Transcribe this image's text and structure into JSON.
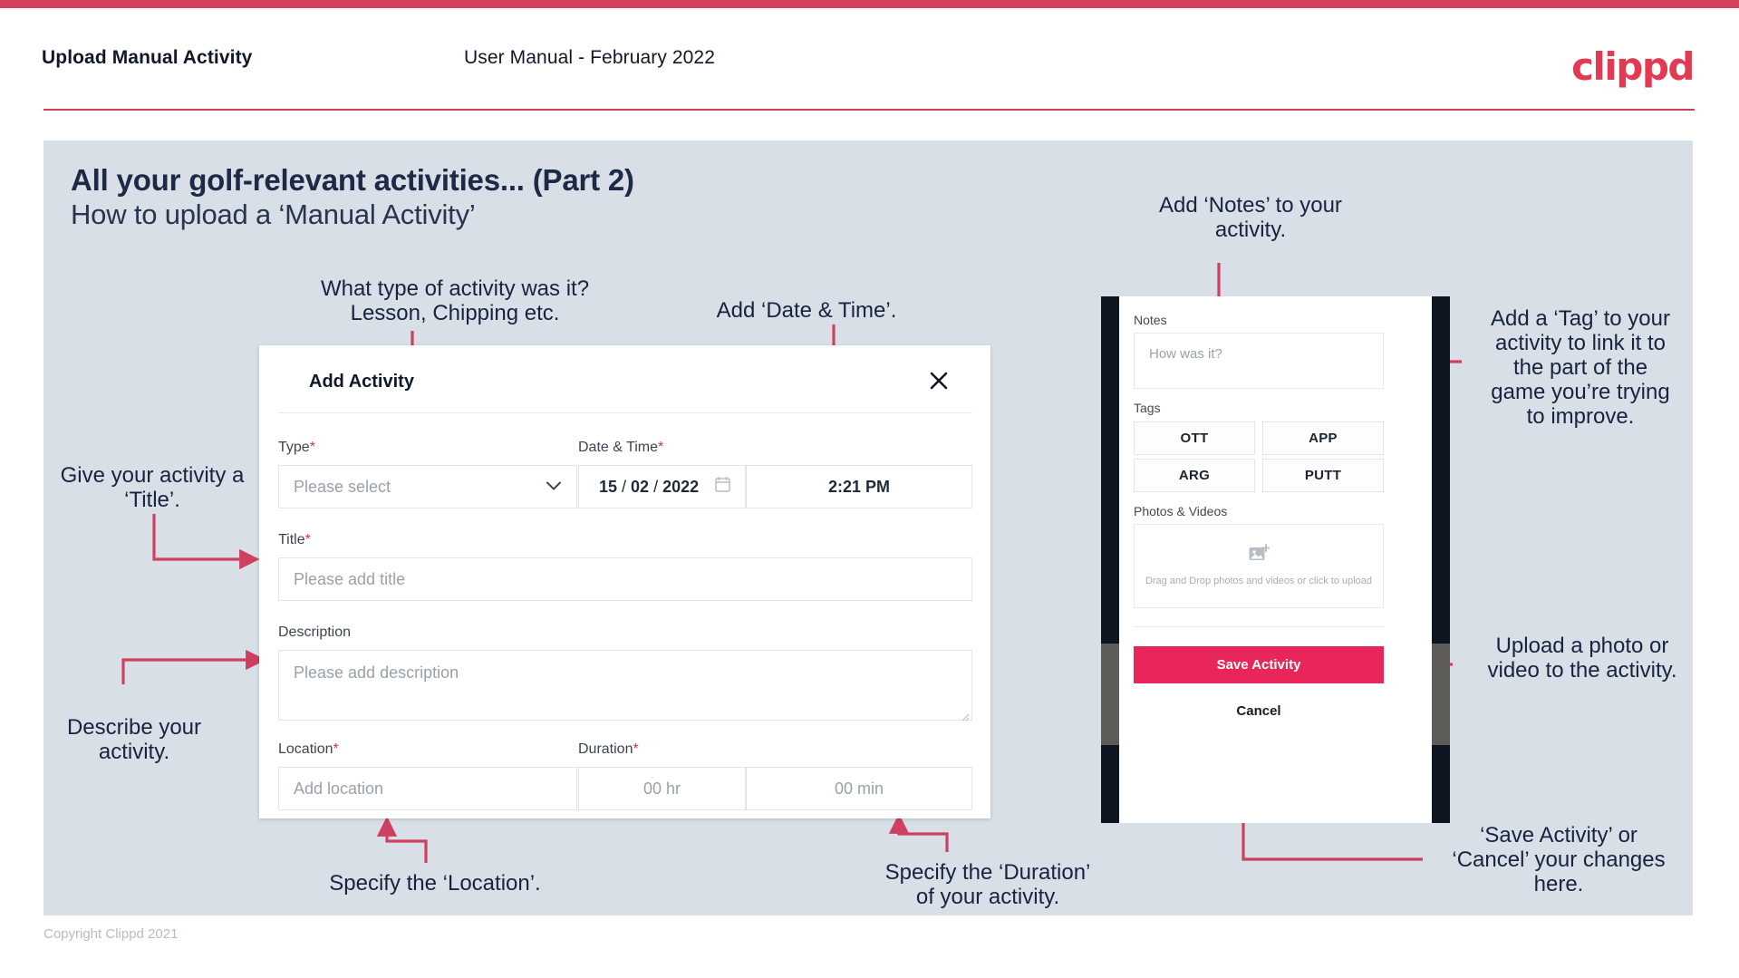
{
  "header": {
    "title": "Upload Manual Activity",
    "subtitle": "User Manual - February 2022",
    "brand": "clippd",
    "accent_color": "#d6425c"
  },
  "slide": {
    "title": "All your golf-relevant activities... (Part 2)",
    "subtitle": "How to upload a ‘Manual Activity’",
    "background_color": "#d8dfe7"
  },
  "annotations": [
    {
      "id": "type-note",
      "text": "What type of activity was it?\nLesson, Chipping etc."
    },
    {
      "id": "datetime-note",
      "text": "Add ‘Date & Time’."
    },
    {
      "id": "title-note",
      "text": "Give your activity a\n‘Title’."
    },
    {
      "id": "desc-note",
      "text": "Describe your\nactivity."
    },
    {
      "id": "location-note",
      "text": "Specify the ‘Location’."
    },
    {
      "id": "duration-note",
      "text": "Specify the ‘Duration’\nof your activity."
    },
    {
      "id": "notes-note",
      "text": "Add ‘Notes’ to your\nactivity."
    },
    {
      "id": "tag-note",
      "text": "Add a ‘Tag’ to your\nactivity to link it to\nthe part of the\ngame you’re trying\nto improve."
    },
    {
      "id": "upload-note",
      "text": "Upload a photo or\nvideo to the activity."
    },
    {
      "id": "save-note",
      "text": "‘Save Activity’ or\n‘Cancel’ your changes\nhere."
    }
  ],
  "dialog": {
    "title": "Add Activity",
    "close_icon": "close-icon",
    "fields": {
      "type": {
        "label": "Type",
        "required": "*",
        "placeholder": "Please select",
        "icon": "chevron-down-icon"
      },
      "datetime": {
        "label": "Date & Time",
        "required": "*",
        "day": "15",
        "month": "02",
        "year": "2022",
        "sep": "/",
        "time": "2:21 PM",
        "icon": "calendar-icon"
      },
      "title": {
        "label": "Title",
        "required": "*",
        "placeholder": "Please add title"
      },
      "description": {
        "label": "Description",
        "required": "",
        "placeholder": "Please add description"
      },
      "location": {
        "label": "Location",
        "required": "*",
        "placeholder": "Add location"
      },
      "duration": {
        "label": "Duration",
        "required": "*",
        "hours_placeholder": "00 hr",
        "minutes_placeholder": "00 min"
      }
    }
  },
  "phone": {
    "notes": {
      "label": "Notes",
      "placeholder": "How was it?"
    },
    "tags": {
      "label": "Tags",
      "items": [
        "OTT",
        "APP",
        "ARG",
        "PUTT"
      ]
    },
    "photos": {
      "label": "Photos & Videos",
      "icon": "add-image-icon",
      "drop_text": "Drag and Drop photos and videos or click to upload"
    },
    "save_label": "Save Activity",
    "cancel_label": "Cancel",
    "save_color": "#e8265a"
  },
  "footer": {
    "copyright": "Copyright Clippd 2021"
  }
}
